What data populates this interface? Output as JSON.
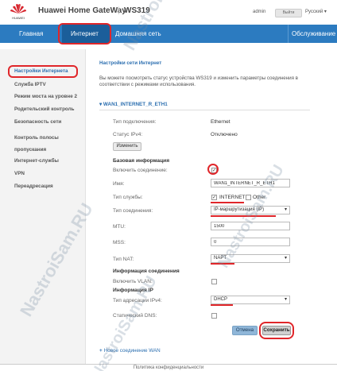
{
  "header": {
    "brand": "Huawei Home GateWay",
    "separator": "|",
    "model": "WS319",
    "logo_text": "HUAWEI",
    "user": "admin",
    "logout": "Выйти",
    "language": "Русский ▾"
  },
  "nav": {
    "tabs": [
      {
        "label": "Главная"
      },
      {
        "label": "Интернет"
      },
      {
        "label": "Домашняя сеть"
      },
      {
        "label": "Обслуживание"
      }
    ]
  },
  "sidebar": {
    "items": [
      {
        "label": "Настройки Интернета"
      },
      {
        "label": "Служба IPTV"
      },
      {
        "label": "Режим моста на уровне 2"
      },
      {
        "label": "Родительский контроль"
      },
      {
        "label": "Безопасность сети"
      },
      {
        "label": "Контроль полосы пропускания"
      },
      {
        "label": "Интернет-службы"
      },
      {
        "label": "VPN"
      },
      {
        "label": "Переадресация"
      }
    ]
  },
  "main": {
    "breadcrumb": "Настройки сети Интернет",
    "description": "Вы можете посмотреть статус устройства WS319 и изменить параметры соединения в соответствии с режимами использования.",
    "wan_name": "WAN1_INTERNET_R_ETH1",
    "connection_type_label": "Тип подключения:",
    "connection_type_value": "Ethernet",
    "ipv4_status_label": "Статус IPv4:",
    "ipv4_status_value": "Отключено",
    "change_button": "Изменить",
    "basic_section": "Базовая информация",
    "enable_label": "Включить соединение:",
    "name_label": "Имя:",
    "name_value": "WAN1_INTERNET_R_ETH1",
    "service_type_label": "Тип службы:",
    "service_internet": "INTERNET",
    "service_other": "Other",
    "conn_type_label": "Тип соединения:",
    "conn_type_value": "IP-маршрутизация (IP)",
    "mtu_label": "MTU:",
    "mtu_value": "1500",
    "mss_label": "MSS:",
    "mss_value": "0",
    "nat_label": "Тип NAT:",
    "nat_value": "NAPT",
    "conn_info_section": "Информация соединения",
    "vlan_label": "Включить VLAN:",
    "ip_info_section": "Информация IP",
    "ipv4_addr_label": "Тип адресации IPv4:",
    "ipv4_addr_value": "DHCP",
    "static_dns_label": "Статический DNS:",
    "cancel_button": "Отмена",
    "save_button": "Сохранить",
    "new_wan": "Новое соединение WAN"
  },
  "footer": {
    "text": "Политика конфиденциальности"
  },
  "watermark": "NastroiSam.RU",
  "colors": {
    "nav_blue": "#2c7bc0",
    "nav_active": "#1b5e9a",
    "highlight_red": "#e0262a",
    "link_blue": "#2c6fb0"
  }
}
